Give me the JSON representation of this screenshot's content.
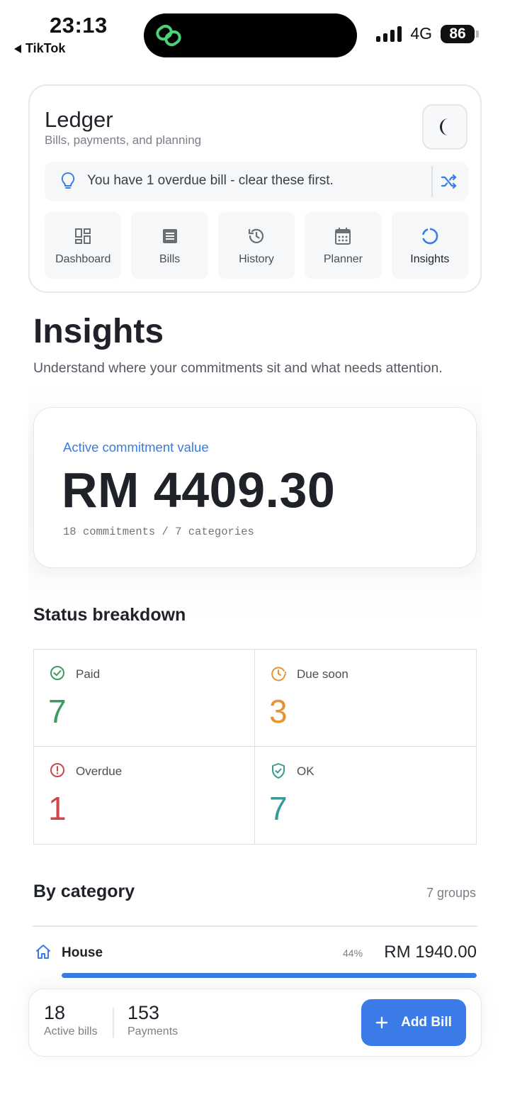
{
  "status_bar": {
    "time": "23:13",
    "back_app": "TikTok",
    "network": "4G",
    "battery": "86"
  },
  "header": {
    "title": "Ledger",
    "subtitle": "Bills, payments, and planning",
    "tip": "You have 1 overdue bill - clear these first.",
    "nav": [
      {
        "label": "Dashboard",
        "icon": "dashboard-icon"
      },
      {
        "label": "Bills",
        "icon": "bills-icon"
      },
      {
        "label": "History",
        "icon": "history-icon"
      },
      {
        "label": "Planner",
        "icon": "calendar-icon"
      },
      {
        "label": "Insights",
        "icon": "insights-icon",
        "active": true
      }
    ]
  },
  "page": {
    "title": "Insights",
    "subtitle": "Understand where your commitments sit and what needs attention."
  },
  "commitment": {
    "label": "Active commitment value",
    "value": "RM 4409.30",
    "meta": "18 commitments / 7 categories"
  },
  "status_breakdown": {
    "title": "Status breakdown",
    "items": [
      {
        "label": "Paid",
        "count": "7",
        "color": "#3f9a62"
      },
      {
        "label": "Due soon",
        "count": "3",
        "color": "#e8922f"
      },
      {
        "label": "Overdue",
        "count": "1",
        "color": "#d0444c"
      },
      {
        "label": "OK",
        "count": "7",
        "color": "#3a9a96"
      }
    ]
  },
  "by_category": {
    "title": "By category",
    "count_label": "7 groups",
    "items": [
      {
        "name": "House",
        "percent_label": "44%",
        "percent": 100,
        "amount": "RM 1940.00"
      }
    ]
  },
  "bottom_bar": {
    "active_bills": "18",
    "active_bills_label": "Active bills",
    "payments": "153",
    "payments_label": "Payments",
    "add_label": "Add Bill"
  },
  "colors": {
    "accent": "#3b7be8",
    "text": "#1f2229",
    "muted": "#7a7f88"
  }
}
